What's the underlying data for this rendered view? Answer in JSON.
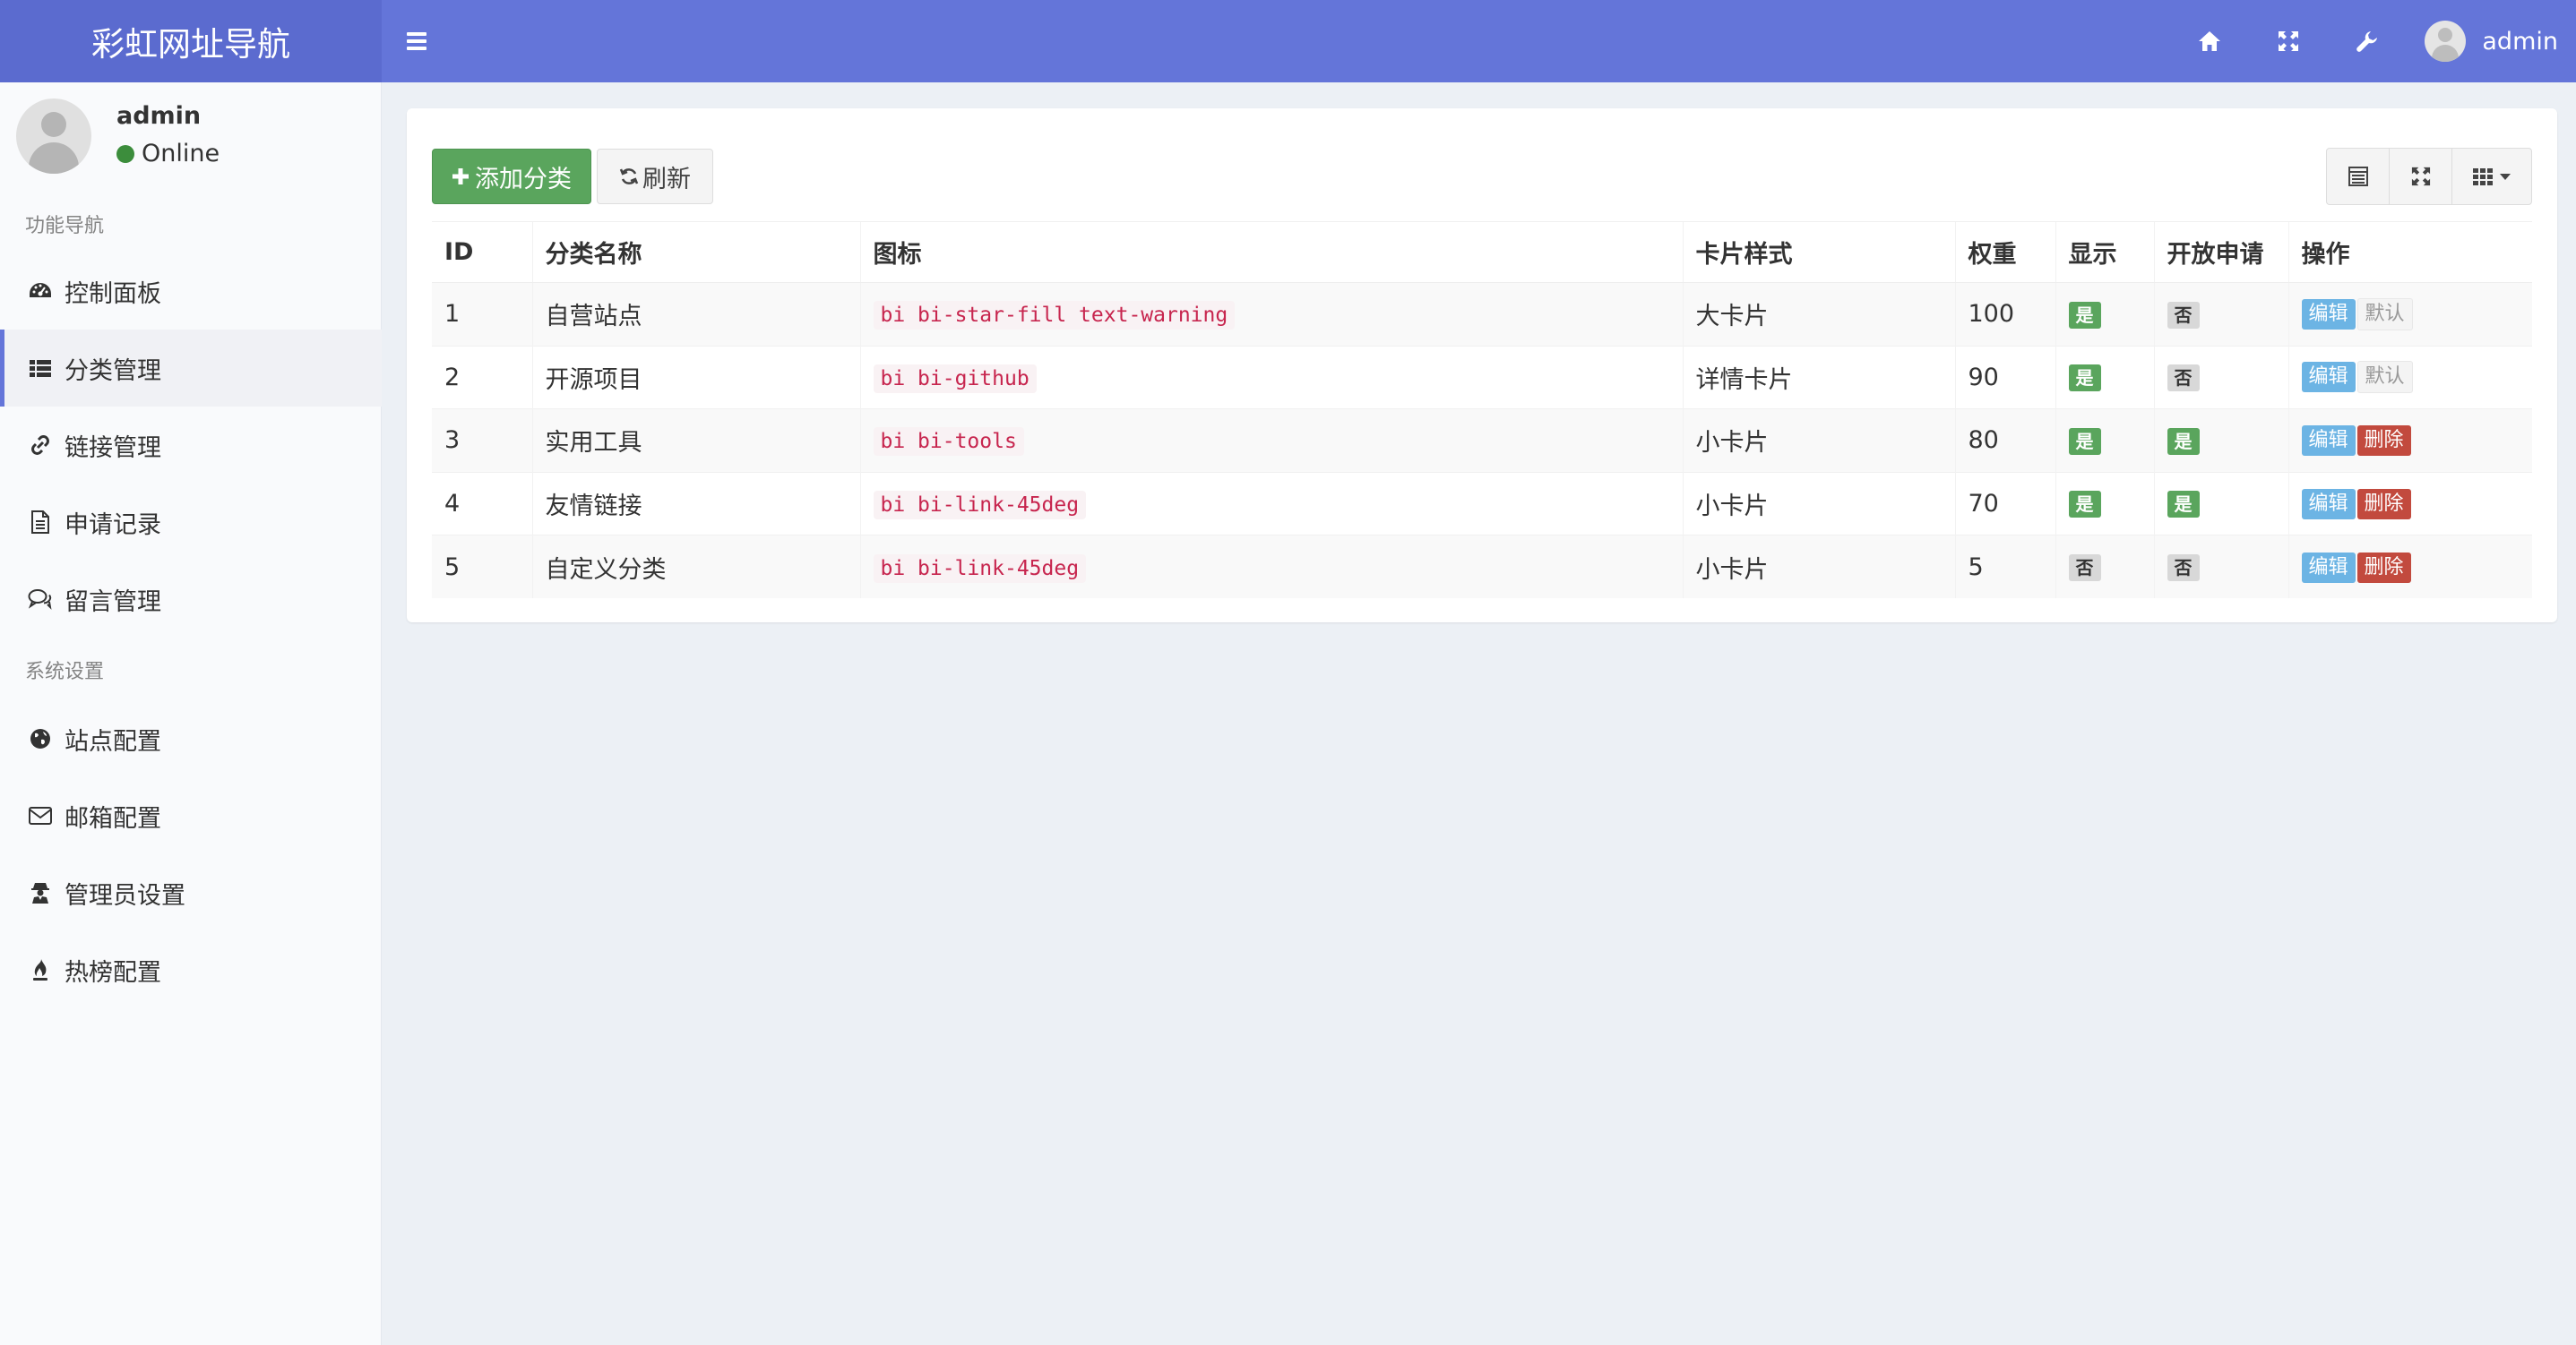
{
  "header": {
    "brand": "彩虹网址导航",
    "username": "admin"
  },
  "sidebar": {
    "user": {
      "name": "admin",
      "status": "Online"
    },
    "section1": "功能导航",
    "section2": "系统设置",
    "items": [
      {
        "label": "控制面板",
        "icon": "dashboard-icon"
      },
      {
        "label": "分类管理",
        "icon": "list-icon"
      },
      {
        "label": "链接管理",
        "icon": "link-icon"
      },
      {
        "label": "申请记录",
        "icon": "file-icon"
      },
      {
        "label": "留言管理",
        "icon": "comments-icon"
      },
      {
        "label": "站点配置",
        "icon": "globe-icon"
      },
      {
        "label": "邮箱配置",
        "icon": "envelope-icon"
      },
      {
        "label": "管理员设置",
        "icon": "user-secret-icon"
      },
      {
        "label": "热榜配置",
        "icon": "fire-icon"
      }
    ]
  },
  "toolbar": {
    "add_label": "添加分类",
    "refresh_label": "刷新"
  },
  "table": {
    "columns": [
      "ID",
      "分类名称",
      "图标",
      "卡片样式",
      "权重",
      "显示",
      "开放申请",
      "操作"
    ],
    "rows": [
      {
        "id": "1",
        "name": "自营站点",
        "icon": "bi bi-star-fill text-warning",
        "style": "大卡片",
        "weight": "100",
        "show": "是",
        "apply": "否",
        "edit": "编辑",
        "action2": "默认"
      },
      {
        "id": "2",
        "name": "开源项目",
        "icon": "bi bi-github",
        "style": "详情卡片",
        "weight": "90",
        "show": "是",
        "apply": "否",
        "edit": "编辑",
        "action2": "默认"
      },
      {
        "id": "3",
        "name": "实用工具",
        "icon": "bi bi-tools",
        "style": "小卡片",
        "weight": "80",
        "show": "是",
        "apply": "是",
        "edit": "编辑",
        "action2": "删除"
      },
      {
        "id": "4",
        "name": "友情链接",
        "icon": "bi bi-link-45deg",
        "style": "小卡片",
        "weight": "70",
        "show": "是",
        "apply": "是",
        "edit": "编辑",
        "action2": "删除"
      },
      {
        "id": "5",
        "name": "自定义分类",
        "icon": "bi bi-link-45deg",
        "style": "小卡片",
        "weight": "5",
        "show": "否",
        "apply": "否",
        "edit": "编辑",
        "action2": "删除"
      }
    ]
  },
  "colors": {
    "header": "#6475d9",
    "success": "#5aa55d",
    "info": "#6cb4e4",
    "danger": "#c24a3e"
  }
}
